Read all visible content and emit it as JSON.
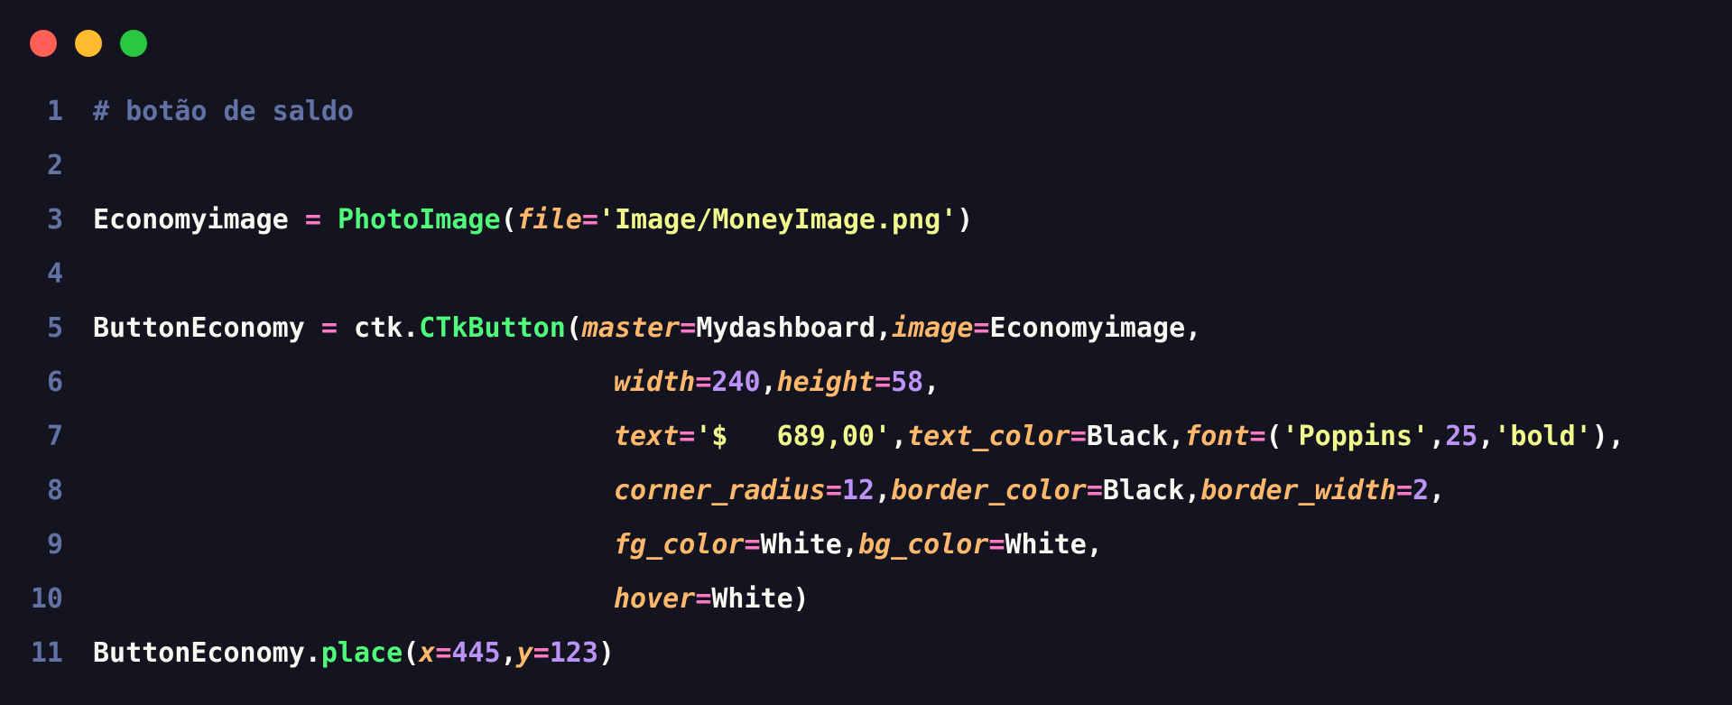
{
  "window": {
    "controls": {
      "close_color": "#ff5f57",
      "minimize_color": "#febc2e",
      "maximize_color": "#28c840"
    }
  },
  "code": {
    "language": "python",
    "lines": [
      {
        "number": "1",
        "tokens": [
          {
            "t": "comment",
            "v": "# botão de saldo"
          }
        ]
      },
      {
        "number": "2",
        "tokens": []
      },
      {
        "number": "3",
        "tokens": [
          {
            "t": "plain",
            "v": "Economyimage "
          },
          {
            "t": "op",
            "v": "="
          },
          {
            "t": "plain",
            "v": " "
          },
          {
            "t": "func",
            "v": "PhotoImage"
          },
          {
            "t": "plain",
            "v": "("
          },
          {
            "t": "param",
            "v": "file"
          },
          {
            "t": "op",
            "v": "="
          },
          {
            "t": "string",
            "v": "'Image/MoneyImage.png'"
          },
          {
            "t": "plain",
            "v": ")"
          }
        ]
      },
      {
        "number": "4",
        "tokens": []
      },
      {
        "number": "5",
        "tokens": [
          {
            "t": "plain",
            "v": "ButtonEconomy "
          },
          {
            "t": "op",
            "v": "="
          },
          {
            "t": "plain",
            "v": " ctk."
          },
          {
            "t": "func",
            "v": "CTkButton"
          },
          {
            "t": "plain",
            "v": "("
          },
          {
            "t": "param",
            "v": "master"
          },
          {
            "t": "op",
            "v": "="
          },
          {
            "t": "plain",
            "v": "Mydashboard,"
          },
          {
            "t": "param",
            "v": "image"
          },
          {
            "t": "op",
            "v": "="
          },
          {
            "t": "plain",
            "v": "Economyimage,"
          }
        ]
      },
      {
        "number": "6",
        "indent": true,
        "tokens": [
          {
            "t": "param",
            "v": "width"
          },
          {
            "t": "op",
            "v": "="
          },
          {
            "t": "number",
            "v": "240"
          },
          {
            "t": "plain",
            "v": ","
          },
          {
            "t": "param",
            "v": "height"
          },
          {
            "t": "op",
            "v": "="
          },
          {
            "t": "number",
            "v": "58"
          },
          {
            "t": "plain",
            "v": ","
          }
        ]
      },
      {
        "number": "7",
        "indent": true,
        "tokens": [
          {
            "t": "param",
            "v": "text"
          },
          {
            "t": "op",
            "v": "="
          },
          {
            "t": "string",
            "v": "'$   689,00'"
          },
          {
            "t": "plain",
            "v": ","
          },
          {
            "t": "param",
            "v": "text_color"
          },
          {
            "t": "op",
            "v": "="
          },
          {
            "t": "plain",
            "v": "Black,"
          },
          {
            "t": "param",
            "v": "font"
          },
          {
            "t": "op",
            "v": "="
          },
          {
            "t": "plain",
            "v": "("
          },
          {
            "t": "string",
            "v": "'Poppins'"
          },
          {
            "t": "plain",
            "v": ","
          },
          {
            "t": "number",
            "v": "25"
          },
          {
            "t": "plain",
            "v": ","
          },
          {
            "t": "string",
            "v": "'bold'"
          },
          {
            "t": "plain",
            "v": "),"
          }
        ]
      },
      {
        "number": "8",
        "indent": true,
        "tokens": [
          {
            "t": "param",
            "v": "corner_radius"
          },
          {
            "t": "op",
            "v": "="
          },
          {
            "t": "number",
            "v": "12"
          },
          {
            "t": "plain",
            "v": ","
          },
          {
            "t": "param",
            "v": "border_color"
          },
          {
            "t": "op",
            "v": "="
          },
          {
            "t": "plain",
            "v": "Black,"
          },
          {
            "t": "param",
            "v": "border_width"
          },
          {
            "t": "op",
            "v": "="
          },
          {
            "t": "number",
            "v": "2"
          },
          {
            "t": "plain",
            "v": ","
          }
        ]
      },
      {
        "number": "9",
        "indent": true,
        "tokens": [
          {
            "t": "param",
            "v": "fg_color"
          },
          {
            "t": "op",
            "v": "="
          },
          {
            "t": "plain",
            "v": "White,"
          },
          {
            "t": "param",
            "v": "bg_color"
          },
          {
            "t": "op",
            "v": "="
          },
          {
            "t": "plain",
            "v": "White,"
          }
        ]
      },
      {
        "number": "10",
        "indent": true,
        "tokens": [
          {
            "t": "param",
            "v": "hover"
          },
          {
            "t": "op",
            "v": "="
          },
          {
            "t": "plain",
            "v": "White)"
          }
        ]
      },
      {
        "number": "11",
        "tokens": [
          {
            "t": "plain",
            "v": "ButtonEconomy."
          },
          {
            "t": "func",
            "v": "place"
          },
          {
            "t": "plain",
            "v": "("
          },
          {
            "t": "param",
            "v": "x"
          },
          {
            "t": "op",
            "v": "="
          },
          {
            "t": "number",
            "v": "445"
          },
          {
            "t": "plain",
            "v": ","
          },
          {
            "t": "param",
            "v": "y"
          },
          {
            "t": "op",
            "v": "="
          },
          {
            "t": "number",
            "v": "123"
          },
          {
            "t": "plain",
            "v": ")"
          }
        ]
      }
    ]
  }
}
